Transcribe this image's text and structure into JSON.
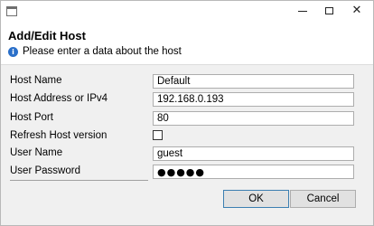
{
  "window": {
    "icon": "application-window-icon",
    "controls": [
      "minimize-icon",
      "maximize-icon",
      "close-icon"
    ],
    "close_glyph": "✕"
  },
  "header": {
    "title": "Add/Edit Host",
    "info_icon": "i",
    "message": "Please enter a data about the host"
  },
  "form": {
    "host_name": {
      "label": "Host Name",
      "value": "Default"
    },
    "host_address": {
      "label": "Host Address or IPv4",
      "value": "192.168.0.193"
    },
    "host_port": {
      "label": "Host Port",
      "value": "80"
    },
    "refresh_host_version": {
      "label": "Refresh Host version",
      "checked": false
    },
    "user_name": {
      "label": "User Name",
      "value": "guest"
    },
    "user_password": {
      "label": "User Password",
      "value": "●●●●●"
    }
  },
  "buttons": {
    "ok": "OK",
    "cancel": "Cancel"
  },
  "colors": {
    "header_background": "#ffffff",
    "body_background": "#f0f0f0",
    "info_icon": "#2a6fc9",
    "default_button_border": "#3c7fb1"
  }
}
